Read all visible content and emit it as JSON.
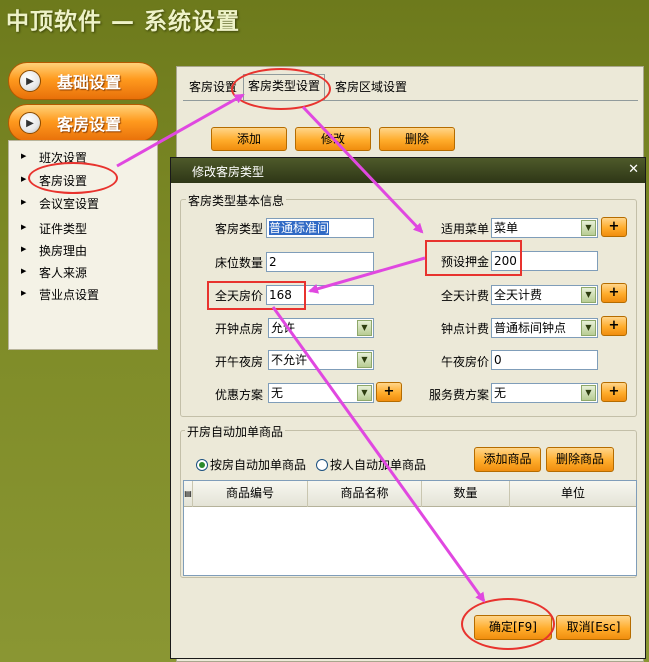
{
  "header": {
    "title": "中顶软件 — 系统设置"
  },
  "sidebar": {
    "buttons": [
      {
        "label": "基础设置"
      },
      {
        "label": "客房设置"
      }
    ],
    "items": [
      {
        "label": "班次设置"
      },
      {
        "label": "客房设置"
      },
      {
        "label": "会议室设置"
      },
      {
        "label": "证件类型"
      },
      {
        "label": "换房理由"
      },
      {
        "label": "客人来源"
      },
      {
        "label": "营业点设置"
      }
    ]
  },
  "main": {
    "tabs": [
      {
        "label": "客房设置"
      },
      {
        "label": "客房类型设置"
      },
      {
        "label": "客房区域设置"
      }
    ],
    "toolbar": {
      "add": "添加",
      "edit": "修改",
      "delete": "删除"
    }
  },
  "dialog": {
    "title": "修改客房类型",
    "close": "✕",
    "basic_group": "客房类型基本信息",
    "fields": {
      "room_type": {
        "label": "客房类型",
        "value": "普通标准间"
      },
      "menu": {
        "label": "适用菜单",
        "value": "菜单"
      },
      "beds": {
        "label": "床位数量",
        "value": "2"
      },
      "deposit": {
        "label": "预设押金",
        "value": "200"
      },
      "day_price": {
        "label": "全天房价",
        "value": "168"
      },
      "day_billing": {
        "label": "全天计费",
        "value": "全天计费"
      },
      "hourly": {
        "label": "开钟点房",
        "value": "允许"
      },
      "hourly_billing": {
        "label": "钟点计费",
        "value": "普通标间钟点"
      },
      "midnight": {
        "label": "开午夜房",
        "value": "不允许"
      },
      "midnight_price": {
        "label": "午夜房价",
        "value": "0"
      },
      "discount": {
        "label": "优惠方案",
        "value": "无"
      },
      "service_fee": {
        "label": "服务费方案",
        "value": "无"
      }
    },
    "plus": "+",
    "auto_group": "开房自动加单商品",
    "radio_by_room": "按房自动加单商品",
    "radio_by_person": "按人自动加单商品",
    "add_goods": "添加商品",
    "delete_goods": "删除商品",
    "grid_columns": [
      "商品编号",
      "商品名称",
      "数量",
      "单位"
    ],
    "confirm": "确定[F9]",
    "cancel": "取消[Esc]"
  }
}
